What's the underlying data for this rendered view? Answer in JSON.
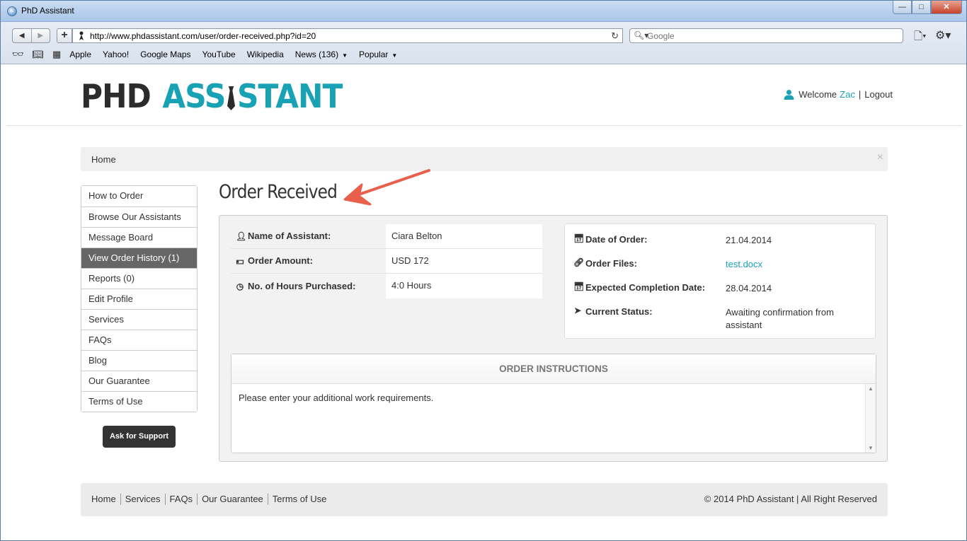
{
  "window": {
    "title": "PhD Assistant",
    "min": "—",
    "max": "□",
    "close": "✕"
  },
  "toolbar": {
    "back": "◀",
    "forward": "▶",
    "add": "+",
    "url": "http://www.phdassistant.com/user/order-received.php?id=20",
    "reload": "↻",
    "search_placeholder": "Google",
    "search_icon": "🔍︎▾",
    "page_menu": "🗋▾",
    "gear_menu": "⚙▾"
  },
  "bookmarks": {
    "reader_icon": "👓︎",
    "book_icon": "📖︎",
    "grid_icon": "▦",
    "items": [
      "Apple",
      "Yahoo!",
      "Google Maps",
      "YouTube",
      "Wikipedia"
    ],
    "news": "News (136)",
    "popular": "Popular",
    "caret": "▼"
  },
  "header": {
    "logo_left": "PHD",
    "logo_right_a": "ASS",
    "logo_right_b": "STANT",
    "welcome": "Welcome",
    "user": "Zac",
    "sep": "|",
    "logout": "Logout"
  },
  "breadcrumb": {
    "home": "Home",
    "close": "×"
  },
  "sidebar": {
    "items": [
      "How to Order",
      "Browse Our Assistants",
      "Message Board",
      "View Order History (1)",
      "Reports (0)",
      "Edit Profile",
      "Services",
      "FAQs",
      "Blog",
      "Our Guarantee",
      "Terms of Use"
    ],
    "support": "Ask for Support"
  },
  "main": {
    "title": "Order Received",
    "left_rows": [
      {
        "icon": "👤︎",
        "label": "Name of Assistant:",
        "value": "Ciara Belton"
      },
      {
        "icon": "💵︎",
        "label": "Order Amount:",
        "value": "USD 172"
      },
      {
        "icon": "◷",
        "label": "No. of Hours Purchased:",
        "value": "4:0 Hours"
      }
    ],
    "right_rows": [
      {
        "icon": "📅︎",
        "label": "Date of Order:",
        "value": "21.04.2014"
      },
      {
        "icon": "🔗︎",
        "label": "Order Files:",
        "value": "test.docx"
      },
      {
        "icon": "📅︎",
        "label": "Expected Completion Date:",
        "value": "28.04.2014"
      },
      {
        "icon": "➤",
        "label": "Current Status:",
        "value": "Awaiting confirmation from assistant"
      }
    ],
    "instructions_title": "ORDER INSTRUCTIONS",
    "instructions_text": "Please enter your additional work requirements.",
    "scroll_up": "▲",
    "scroll_down": "▼"
  },
  "footer": {
    "links": [
      "Home",
      "Services",
      "FAQs",
      "Our Guarantee",
      "Terms of Use"
    ],
    "copyright": "© 2014 PhD Assistant | All Right Reserved"
  },
  "colors": {
    "accent": "#19a2b4",
    "dark": "#333333",
    "arrow": "#e8604c"
  }
}
